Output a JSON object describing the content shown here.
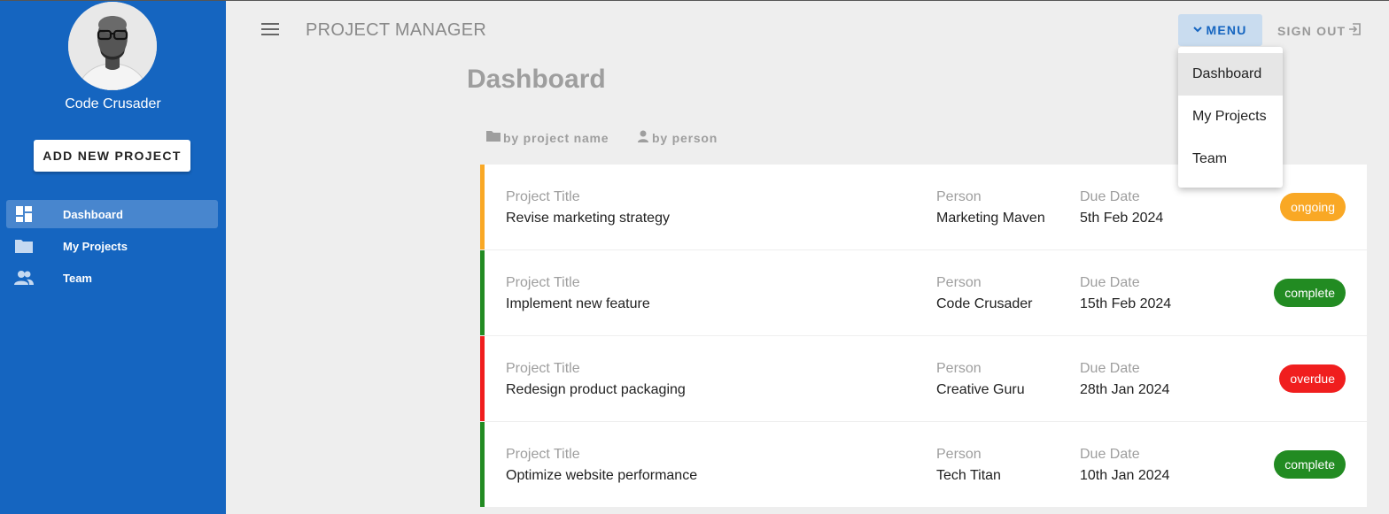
{
  "colors": {
    "sidebar": "#1565c0",
    "ongoing": "#f9a825",
    "complete": "#228b22",
    "overdue": "#f01e1e"
  },
  "sidebar": {
    "username": "Code Crusader",
    "add_button": "ADD NEW PROJECT",
    "items": [
      {
        "label": "Dashboard",
        "icon": "dashboard-icon",
        "active": true
      },
      {
        "label": "My Projects",
        "icon": "folder-icon",
        "active": false
      },
      {
        "label": "Team",
        "icon": "people-icon",
        "active": false
      }
    ]
  },
  "header": {
    "title": "PROJECT MANAGER",
    "menu_button": "MENU",
    "signout": "SIGN OUT"
  },
  "dropdown": {
    "items": [
      "Dashboard",
      "My Projects",
      "Team"
    ]
  },
  "main": {
    "title": "Dashboard",
    "sort_by_name": "by project name",
    "sort_by_person": "by person",
    "labels": {
      "title": "Project Title",
      "person": "Person",
      "due": "Due Date"
    },
    "projects": [
      {
        "title": "Revise marketing strategy",
        "person": "Marketing Maven",
        "due": "5th Feb 2024",
        "status": "ongoing"
      },
      {
        "title": "Implement new feature",
        "person": "Code Crusader",
        "due": "15th Feb 2024",
        "status": "complete"
      },
      {
        "title": "Redesign product packaging",
        "person": "Creative Guru",
        "due": "28th Jan 2024",
        "status": "overdue"
      },
      {
        "title": "Optimize website performance",
        "person": "Tech Titan",
        "due": "10th Jan 2024",
        "status": "complete"
      }
    ]
  }
}
